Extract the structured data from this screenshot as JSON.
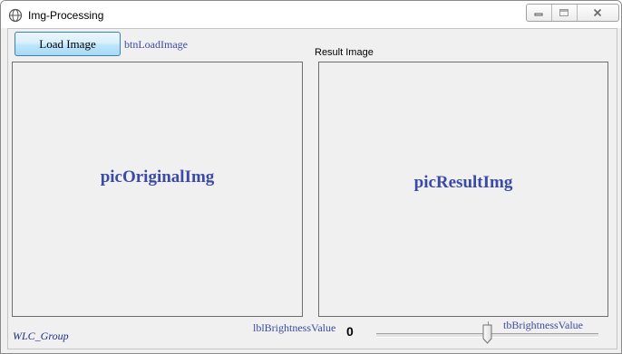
{
  "window": {
    "title": "Img-Processing",
    "icon": "app-globe-icon",
    "controls": [
      "minimize-icon",
      "maximize-icon",
      "close-icon"
    ]
  },
  "toolbar": {
    "load_button_label": "Load Image",
    "load_button_name_label": "btnLoadImage"
  },
  "panels": {
    "result_caption": "Result Image",
    "original_placeholder": "picOriginalImg",
    "result_placeholder": "picResultImg"
  },
  "footer": {
    "group_label": "WLC_Group",
    "brightness_label_name": "lblBrightnessValue",
    "brightness_value": "0",
    "trackbar_name": "tbBrightnessValue",
    "trackbar_position_fraction": 0.5
  },
  "colors": {
    "design_label": "#3b4aa6",
    "button_border": "#3c7fb1"
  }
}
